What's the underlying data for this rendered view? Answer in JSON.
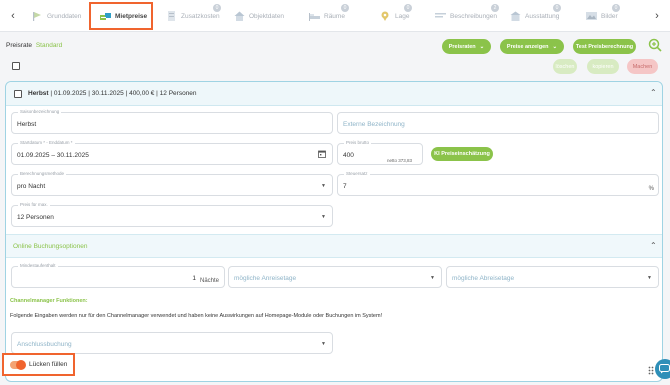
{
  "tabs": [
    {
      "label": "Grunddaten",
      "icon": "flag-icon",
      "badge": ""
    },
    {
      "label": "Mietpreise",
      "icon": "coins-icon",
      "badge": ""
    },
    {
      "label": "Zusatzkosten",
      "icon": "receipt-icon",
      "badge": "0"
    },
    {
      "label": "Objektdaten",
      "icon": "house-icon",
      "badge": ""
    },
    {
      "label": "Räume",
      "icon": "bed-icon",
      "badge": "0"
    },
    {
      "label": "Lage",
      "icon": "location-icon",
      "badge": "0"
    },
    {
      "label": "Beschreibungen",
      "icon": "text-lines-icon",
      "badge": "2"
    },
    {
      "label": "Ausstattung",
      "icon": "building-icon",
      "badge": "0"
    },
    {
      "label": "Bilder",
      "icon": "image-icon",
      "badge": "0"
    }
  ],
  "preisrate": {
    "label": "Preisrate",
    "value": "Standard"
  },
  "buttons": {
    "preisraten": "Preisraten",
    "preise_anzeigen": "Preise anzeigen",
    "test": "Test Preisberechnung",
    "loeschen": "löschen",
    "kopieren": "kopieren",
    "machen": "Machen"
  },
  "season": {
    "name": "Herbst",
    "summary": " | 01.09.2025 | 30.11.2025 | 400,00 € | 12 Personen"
  },
  "fields": {
    "saisonbezeichnung": {
      "label": "Saisonbezeichnung",
      "value": "Herbst"
    },
    "externe_bezeichnung": {
      "placeholder": "Externe Bezeichnung"
    },
    "daterange": {
      "label": "Startdatum * - Enddatum *",
      "value": "01.09.2025 – 30.11.2025"
    },
    "preis_brutto": {
      "label": "Preis brutto",
      "value": "400",
      "hint": "netto 373,83"
    },
    "ki_button": "KI Preiseinschätzung",
    "berechnungsmethode": {
      "label": "Berechnungsmethode",
      "value": "pro Nacht"
    },
    "steuersatz": {
      "label": "Steuersatz",
      "value": "7",
      "suffix": "%"
    },
    "preis_fuer_max": {
      "label": "Preis für max.",
      "value": "12 Personen"
    },
    "mindestaufenthalt": {
      "label": "Mindestaufenthalt",
      "value": "1",
      "suffix": "Nächte"
    },
    "anreisetage": {
      "placeholder": "mögliche Anreisetage"
    },
    "abreisetage": {
      "placeholder": "mögliche Abreisetage"
    },
    "anschlussbuchung": {
      "placeholder": "Anschlussbuchung"
    }
  },
  "online_section": "Online Buchungsoptionen",
  "channelmanager": {
    "title": "Channelmanager Funktionen:",
    "text": "Folgende Eingaben werden nur für den Channelmanager verwendet und haben keine Auswirkungen auf Homepage-Module oder Buchungen im System!"
  },
  "toggle": {
    "label": "Lücken füllen",
    "on": true
  },
  "colors": {
    "accent": "#8bc34a",
    "highlight": "#f0642e",
    "border": "#9fd3e3"
  }
}
